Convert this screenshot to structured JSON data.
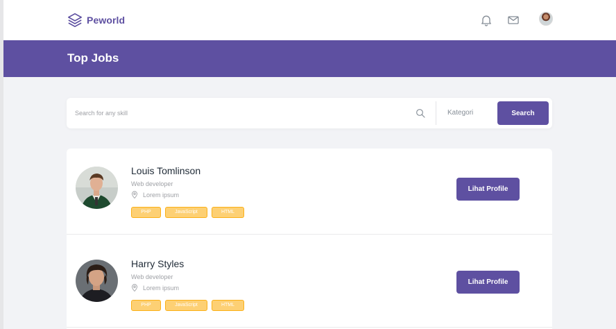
{
  "navbar": {
    "brand": "Peworld",
    "icons": [
      "layers-logo-icon",
      "bell-icon",
      "mail-icon",
      "user-avatar"
    ]
  },
  "header": {
    "title": "Top Jobs"
  },
  "search": {
    "placeholder": "Search for any skill",
    "category_label": "Kategori",
    "button_label": "Search"
  },
  "profiles": [
    {
      "name": "Louis Tomlinson",
      "role": "Web developer",
      "location": "Lorem ipsum",
      "skills": [
        "PHP",
        "JavaScript",
        "HTML"
      ],
      "button_label": "Lihat Profile"
    },
    {
      "name": "Harry Styles",
      "role": "Web developer",
      "location": "Lorem ipsum",
      "skills": [
        "PHP",
        "JavaScript",
        "HTML"
      ],
      "button_label": "Lihat Profile"
    }
  ],
  "colors": {
    "primary": "#5e50a1",
    "skill_badge": "#fbb017",
    "background": "#f2f3f6"
  }
}
